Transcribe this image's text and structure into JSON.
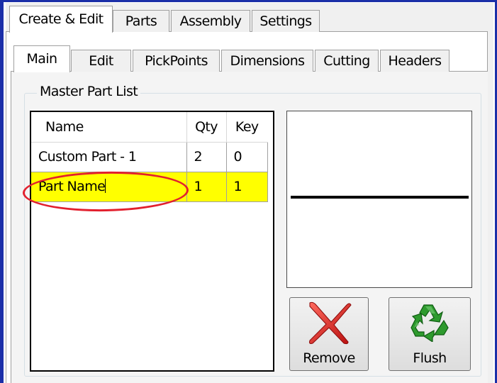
{
  "outer_tabs": [
    "Create & Edit",
    "Parts",
    "Assembly",
    "Settings"
  ],
  "inner_tabs": [
    "Main",
    "Edit",
    "PickPoints",
    "Dimensions",
    "Cutting",
    "Headers"
  ],
  "group_title": "Master Part List",
  "grid": {
    "columns": [
      "Name",
      "Qty",
      "Key"
    ],
    "rows": [
      {
        "name": "Custom Part - 1",
        "qty": "2",
        "key": "0"
      },
      {
        "name": "Part Name",
        "qty": "1",
        "key": "1",
        "selected": true,
        "editing": true
      }
    ]
  },
  "buttons": {
    "remove": "Remove",
    "flush": "Flush"
  },
  "icons": {
    "remove": "red-x-icon",
    "flush": "recycle-icon"
  },
  "colors": {
    "selected_row": "#ffff00",
    "highlight_oval": "#e2202e",
    "window_frame": "#1b2fa8"
  }
}
